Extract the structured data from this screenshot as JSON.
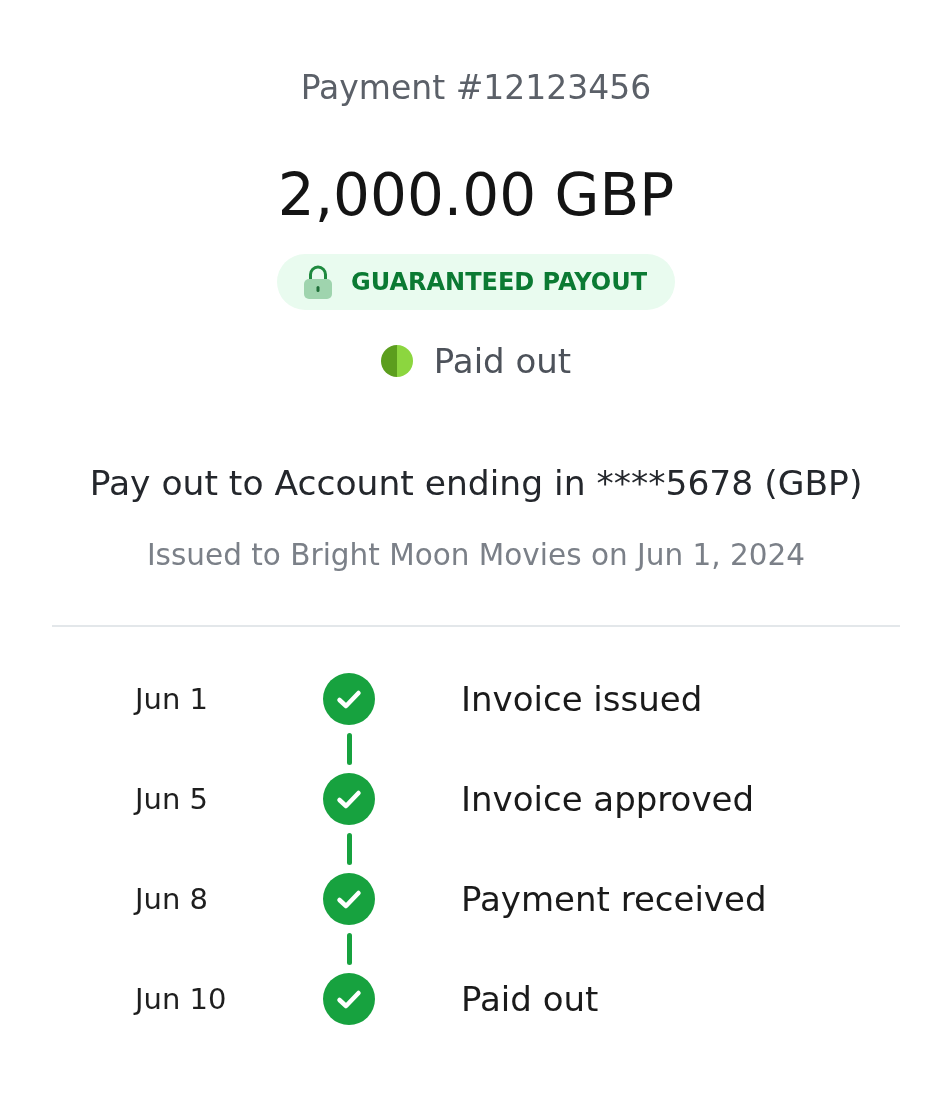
{
  "payment": {
    "title": "Payment #12123456",
    "amount": "2,000.00 GBP",
    "badge": {
      "label": "GUARANTEED PAYOUT"
    },
    "status": {
      "label": "Paid out"
    }
  },
  "payout": {
    "destination": "Pay out to Account ending in ****5678 (GBP)",
    "issued": "Issued to Bright Moon Movies on Jun 1, 2024"
  },
  "timeline": [
    {
      "date": "Jun 1",
      "label": "Invoice issued",
      "done": true
    },
    {
      "date": "Jun 5",
      "label": "Invoice approved",
      "done": true
    },
    {
      "date": "Jun 8",
      "label": "Payment received",
      "done": true
    },
    {
      "date": "Jun 10",
      "label": "Paid out",
      "done": true
    }
  ]
}
